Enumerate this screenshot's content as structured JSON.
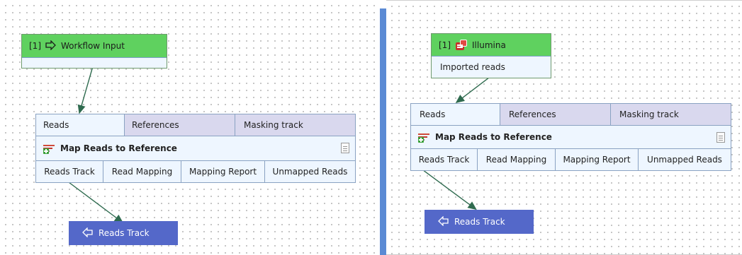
{
  "left": {
    "input_node": {
      "index": "[1]",
      "icon": "arrow-right-outline-icon",
      "title": "Workflow Input"
    },
    "tool_node": {
      "inputs": [
        "Reads",
        "References",
        "Masking track"
      ],
      "icon": "map-reads-icon",
      "title": "Map Reads to Reference",
      "doc_icon": "document-icon",
      "outputs": [
        "Reads Track",
        "Read Mapping",
        "Mapping Report",
        "Unmapped Reads"
      ]
    },
    "output_node": {
      "icon": "arrow-left-outline-icon",
      "title": "Reads Track"
    }
  },
  "right": {
    "input_node": {
      "index": "[1]",
      "icon": "illumina-icon",
      "title": "Illumina",
      "output": "Imported reads"
    },
    "tool_node": {
      "inputs": [
        "Reads",
        "References",
        "Masking track"
      ],
      "icon": "map-reads-icon",
      "title": "Map Reads to Reference",
      "doc_icon": "document-icon",
      "outputs": [
        "Reads Track",
        "Read Mapping",
        "Mapping Report",
        "Unmapped Reads"
      ]
    },
    "output_node": {
      "icon": "arrow-left-outline-icon",
      "title": "Reads Track"
    }
  },
  "colors": {
    "input_header": "#5fd15f",
    "port_active": "#eef6ff",
    "port_inactive": "#d9d8ee",
    "output_node": "#5468c9",
    "divider": "#5b8ad4"
  }
}
